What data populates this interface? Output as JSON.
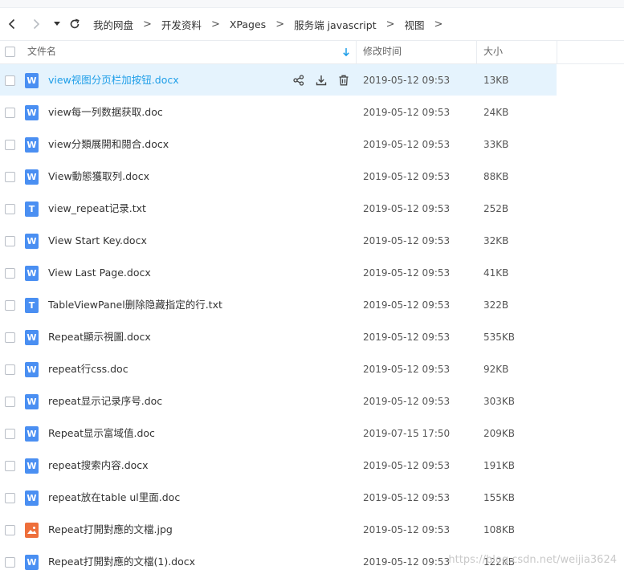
{
  "toolbar": {
    "back_icon": "chevron-left-icon",
    "forward_icon": "chevron-right-icon",
    "history_icon": "caret-down-icon",
    "refresh_icon": "refresh-icon",
    "breadcrumb": [
      "我的网盘",
      "开发资料",
      "XPages",
      "服务端 javascript",
      "视图"
    ],
    "separator": ">"
  },
  "header": {
    "name": "文件名",
    "modified": "修改时间",
    "size": "大小",
    "sort_icon": "arrow-down-icon",
    "accent": "#1e9ee8"
  },
  "files": [
    {
      "name": "view视图分页栏加按钮.docx",
      "type": "word",
      "icon": "W",
      "date": "2019-05-12 09:53",
      "size": "13KB",
      "selected": true
    },
    {
      "name": "view每一列数据获取.doc",
      "type": "word",
      "icon": "W",
      "date": "2019-05-12 09:53",
      "size": "24KB"
    },
    {
      "name": "view分類展開和閱合.docx",
      "type": "word",
      "icon": "W",
      "date": "2019-05-12 09:53",
      "size": "33KB"
    },
    {
      "name": "View動態獲取列.docx",
      "type": "word",
      "icon": "W",
      "date": "2019-05-12 09:53",
      "size": "88KB"
    },
    {
      "name": "view_repeat记录.txt",
      "type": "txt",
      "icon": "T",
      "date": "2019-05-12 09:53",
      "size": "252B"
    },
    {
      "name": "View Start Key.docx",
      "type": "word",
      "icon": "W",
      "date": "2019-05-12 09:53",
      "size": "32KB"
    },
    {
      "name": "View Last Page.docx",
      "type": "word",
      "icon": "W",
      "date": "2019-05-12 09:53",
      "size": "41KB"
    },
    {
      "name": "TableViewPanel删除隐藏指定的行.txt",
      "type": "txt",
      "icon": "T",
      "date": "2019-05-12 09:53",
      "size": "322B"
    },
    {
      "name": "Repeat顯示視圖.docx",
      "type": "word",
      "icon": "W",
      "date": "2019-05-12 09:53",
      "size": "535KB"
    },
    {
      "name": "repeat行css.doc",
      "type": "word",
      "icon": "W",
      "date": "2019-05-12 09:53",
      "size": "92KB"
    },
    {
      "name": "repeat显示记录序号.doc",
      "type": "word",
      "icon": "W",
      "date": "2019-05-12 09:53",
      "size": "303KB"
    },
    {
      "name": "Repeat显示富域值.doc",
      "type": "word",
      "icon": "W",
      "date": "2019-07-15 17:50",
      "size": "209KB"
    },
    {
      "name": "repeat搜索内容.docx",
      "type": "word",
      "icon": "W",
      "date": "2019-05-12 09:53",
      "size": "191KB"
    },
    {
      "name": "repeat放在table ul里面.doc",
      "type": "word",
      "icon": "W",
      "date": "2019-05-12 09:53",
      "size": "155KB"
    },
    {
      "name": "Repeat打開對應的文檔.jpg",
      "type": "img",
      "icon": "image-icon",
      "date": "2019-05-12 09:53",
      "size": "108KB"
    },
    {
      "name": "Repeat打開對應的文檔(1).docx",
      "type": "word",
      "icon": "W",
      "date": "2019-05-12 09:53",
      "size": "122KB"
    }
  ],
  "row_actions": [
    "share-icon",
    "download-icon",
    "delete-icon"
  ],
  "watermark": "https://blog.csdn.net/weijia3624"
}
